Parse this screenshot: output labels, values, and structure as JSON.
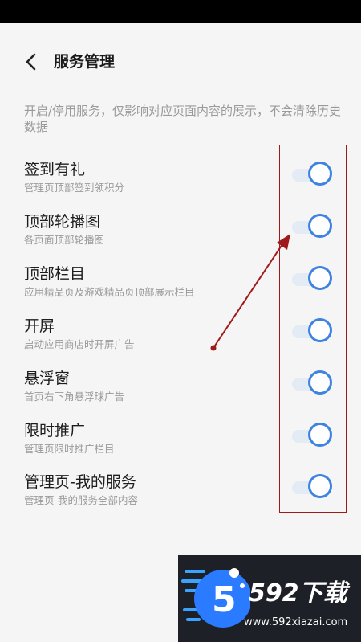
{
  "header": {
    "title": "服务管理",
    "back_icon": "chevron-left-icon"
  },
  "description": "开启/停用服务，仅影响对应页面内容的展示，不会清除历史数据",
  "items": [
    {
      "title": "签到有礼",
      "subtitle": "管理页顶部签到领积分",
      "enabled": true
    },
    {
      "title": "顶部轮播图",
      "subtitle": "各页面顶部轮播图",
      "enabled": true
    },
    {
      "title": "顶部栏目",
      "subtitle": "应用精品页及游戏精品页顶部展示栏目",
      "enabled": true
    },
    {
      "title": "开屏",
      "subtitle": "启动应用商店时开屏广告",
      "enabled": true
    },
    {
      "title": "悬浮窗",
      "subtitle": "首页右下角悬浮球广告",
      "enabled": true
    },
    {
      "title": "限时推广",
      "subtitle": "管理页限时推广栏目",
      "enabled": true
    },
    {
      "title": "管理页-我的服务",
      "subtitle": "管理页-我的服务全部内容",
      "enabled": true
    }
  ],
  "colors": {
    "toggle_on": "#3f83e0",
    "annotation": "#a01a1a"
  },
  "watermark": {
    "brand": "592下载",
    "url": "www.592xiazai.com"
  }
}
